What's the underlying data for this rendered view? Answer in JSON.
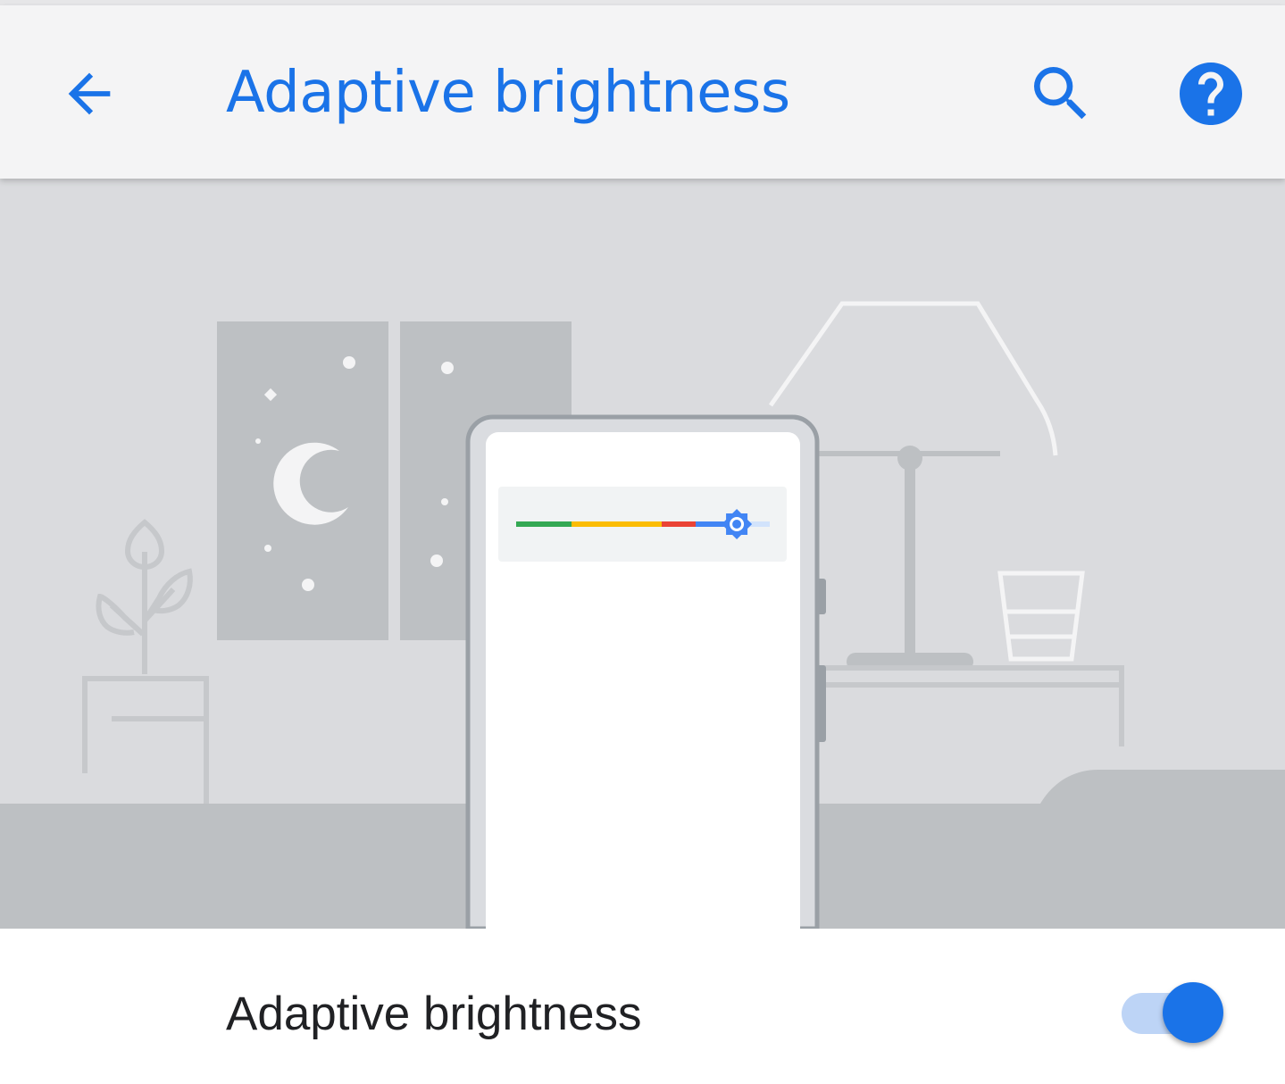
{
  "app_bar": {
    "title": "Adaptive brightness",
    "back_icon": "arrow-back-icon",
    "search_icon": "search-icon",
    "help_icon": "help-icon"
  },
  "illustration": {
    "description_icons": [
      "window-night-icon",
      "moon-icon",
      "plant-icon",
      "lamp-icon",
      "glass-icon",
      "phone-icon",
      "brightness-slider-icon"
    ],
    "slider_level": 0.87
  },
  "setting": {
    "label": "Adaptive brightness",
    "toggle_on": true
  },
  "colors": {
    "accent": "#1a73e8",
    "app_bar_bg": "#f4f4f5",
    "illustration_bg": "#dadbde",
    "floor": "#bdc0c3",
    "toggle_track": "#bdd4f6",
    "slider_green": "#34a853",
    "slider_yellow": "#fbbc04",
    "slider_red": "#ea4335",
    "slider_blue": "#4285f4"
  }
}
